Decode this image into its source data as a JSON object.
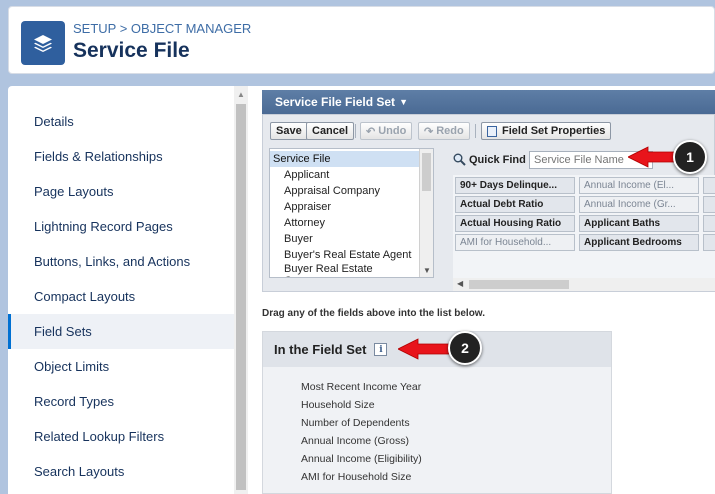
{
  "header": {
    "breadcrumb": "SETUP > OBJECT MANAGER",
    "title": "Service File"
  },
  "nav": {
    "items": [
      {
        "label": "Details"
      },
      {
        "label": "Fields & Relationships"
      },
      {
        "label": "Page Layouts"
      },
      {
        "label": "Lightning Record Pages"
      },
      {
        "label": "Buttons, Links, and Actions"
      },
      {
        "label": "Compact Layouts"
      },
      {
        "label": "Field Sets"
      },
      {
        "label": "Object Limits"
      },
      {
        "label": "Record Types"
      },
      {
        "label": "Related Lookup Filters"
      },
      {
        "label": "Search Layouts"
      }
    ],
    "active": "Field Sets"
  },
  "fieldset": {
    "header": "Service File Field Set",
    "toolbar": {
      "save": "Save",
      "cancel": "Cancel",
      "undo": "Undo",
      "redo": "Redo",
      "properties": "Field Set Properties"
    },
    "objects": [
      "Service File",
      "Applicant",
      "Appraisal Company",
      "Appraiser",
      "Attorney",
      "Buyer",
      "Buyer's Real Estate Agent",
      "Buyer Real Estate Company"
    ],
    "quick_find": {
      "label": "Quick Find",
      "placeholder": "Service File Name"
    },
    "grid": [
      [
        "90+ Days Delinque...",
        "Annual Income (El..."
      ],
      [
        "Actual Debt Ratio",
        "Annual Income (Gr..."
      ],
      [
        "Actual Housing Ratio",
        "Applicant Baths"
      ],
      [
        "AMI for Household...",
        "Applicant Bedrooms"
      ]
    ],
    "drag_hint": "Drag any of the fields above into the list below.",
    "in_set": {
      "title": "In the Field Set",
      "info": "i",
      "items": [
        "Most Recent Income Year",
        "Household Size",
        "Number of Dependents",
        "Annual Income (Gross)",
        "Annual Income (Eligibility)",
        "AMI for Household Size"
      ]
    }
  },
  "callouts": [
    "1",
    "2"
  ],
  "colors": {
    "brand_tile": "#2f5f9e",
    "background": "#b0c4df",
    "active_nav_bar": "#0070d2",
    "fieldset_header": "#4a6a94",
    "callout_arrow": "#e8141b"
  }
}
